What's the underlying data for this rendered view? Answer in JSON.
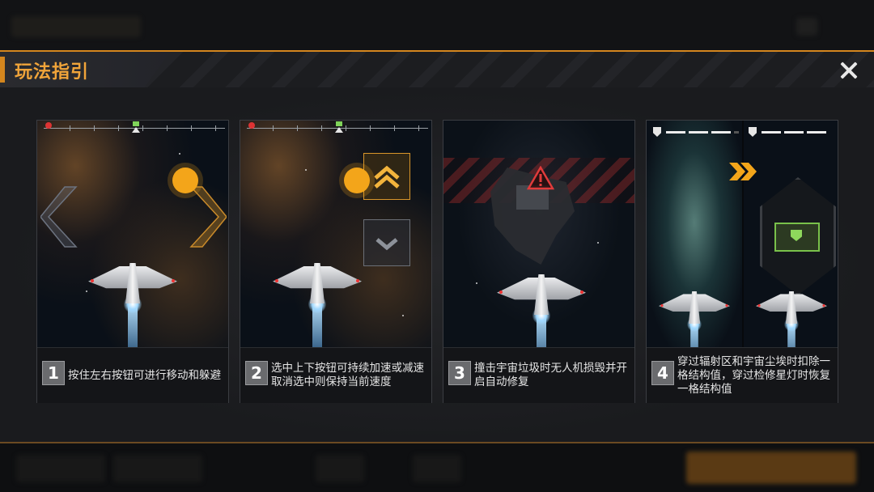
{
  "dialog": {
    "title": "玩法指引",
    "close_icon": "close-icon",
    "accent_color": "#d4861e",
    "title_color": "#f0a43a"
  },
  "cards": [
    {
      "number": "1",
      "text": "按住左右按钮可进行移动和躲避",
      "scene": "move-left-right"
    },
    {
      "number": "2",
      "text": "选中上下按钮可持续加速或减速取消选中则保持当前速度",
      "scene": "speed-up-down"
    },
    {
      "number": "3",
      "text": "撞击宇宙垃圾时无人机损毁并开启自动修复",
      "scene": "space-debris-warning"
    },
    {
      "number": "4",
      "text": "穿过辐射区和宇宙尘埃时扣除一格结构值，穿过检修星灯时恢复一格结构值",
      "scene": "radiation-and-repair-gate"
    }
  ],
  "colors": {
    "button_active": "#f3a51a",
    "warning": "#e03b3b",
    "repair": "#79c14a"
  }
}
